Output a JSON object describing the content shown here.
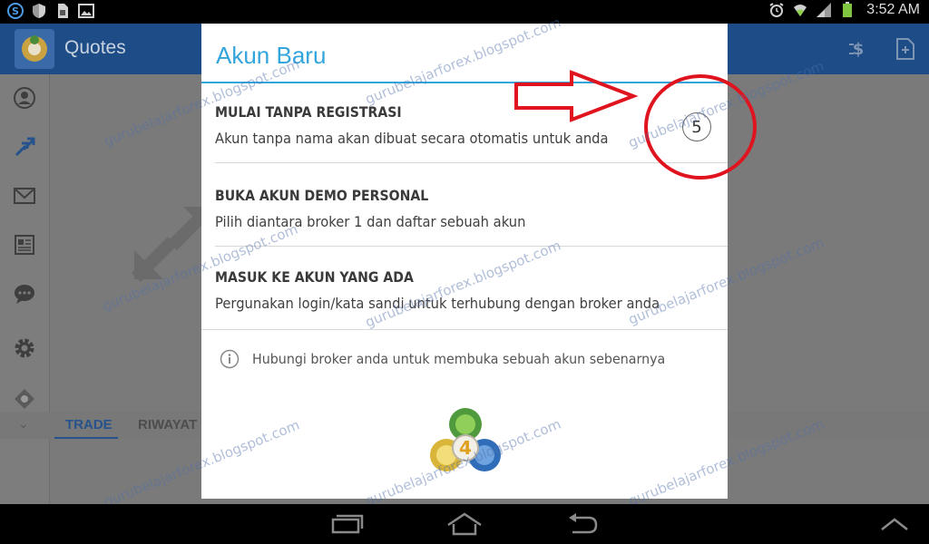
{
  "status_bar": {
    "time": "3:52 AM",
    "left_icons": [
      "s-app-icon",
      "shield-icon",
      "sim-icon",
      "image-icon"
    ],
    "right_icons": [
      "alarm-icon",
      "wifi-icon",
      "signal-icon",
      "battery-icon"
    ]
  },
  "app": {
    "title": "Quotes",
    "actions": [
      "currency-icon",
      "add-document-icon"
    ],
    "side_nav": [
      "account-icon",
      "quotes-icon",
      "mail-icon",
      "news-icon",
      "chat-icon",
      "settings-icon",
      "mql-icon"
    ],
    "tabs": [
      {
        "label": "TRADE",
        "active": true
      },
      {
        "label": "RIWAYAT",
        "active": false
      }
    ]
  },
  "dialog": {
    "title": "Akun Baru",
    "accent_color": "#33a5dd",
    "options": [
      {
        "title": "MULAI TANPA REGISTRASI",
        "description": "Akun tanpa nama akan dibuat secara otomatis untuk anda"
      },
      {
        "title": "BUKA AKUN DEMO PERSONAL",
        "description": "Pilih diantara broker 1 dan daftar sebuah akun"
      },
      {
        "title": "MASUK KE AKUN YANG ADA",
        "description": "Pergunakan login/kata sandi untuk terhubung dengan broker anda"
      }
    ],
    "countdown": "5",
    "info_text": "Hubungi broker anda untuk membuka sebuah akun sebenarnya",
    "logo_label": "4"
  },
  "watermark": {
    "text": "gurubelajarforex.blogspot.com",
    "color": "#506eaa"
  },
  "annotation": {
    "color": "#e0141e"
  },
  "nav_bar": [
    "recent-apps-icon",
    "home-icon",
    "back-icon",
    "collapse-icon"
  ]
}
